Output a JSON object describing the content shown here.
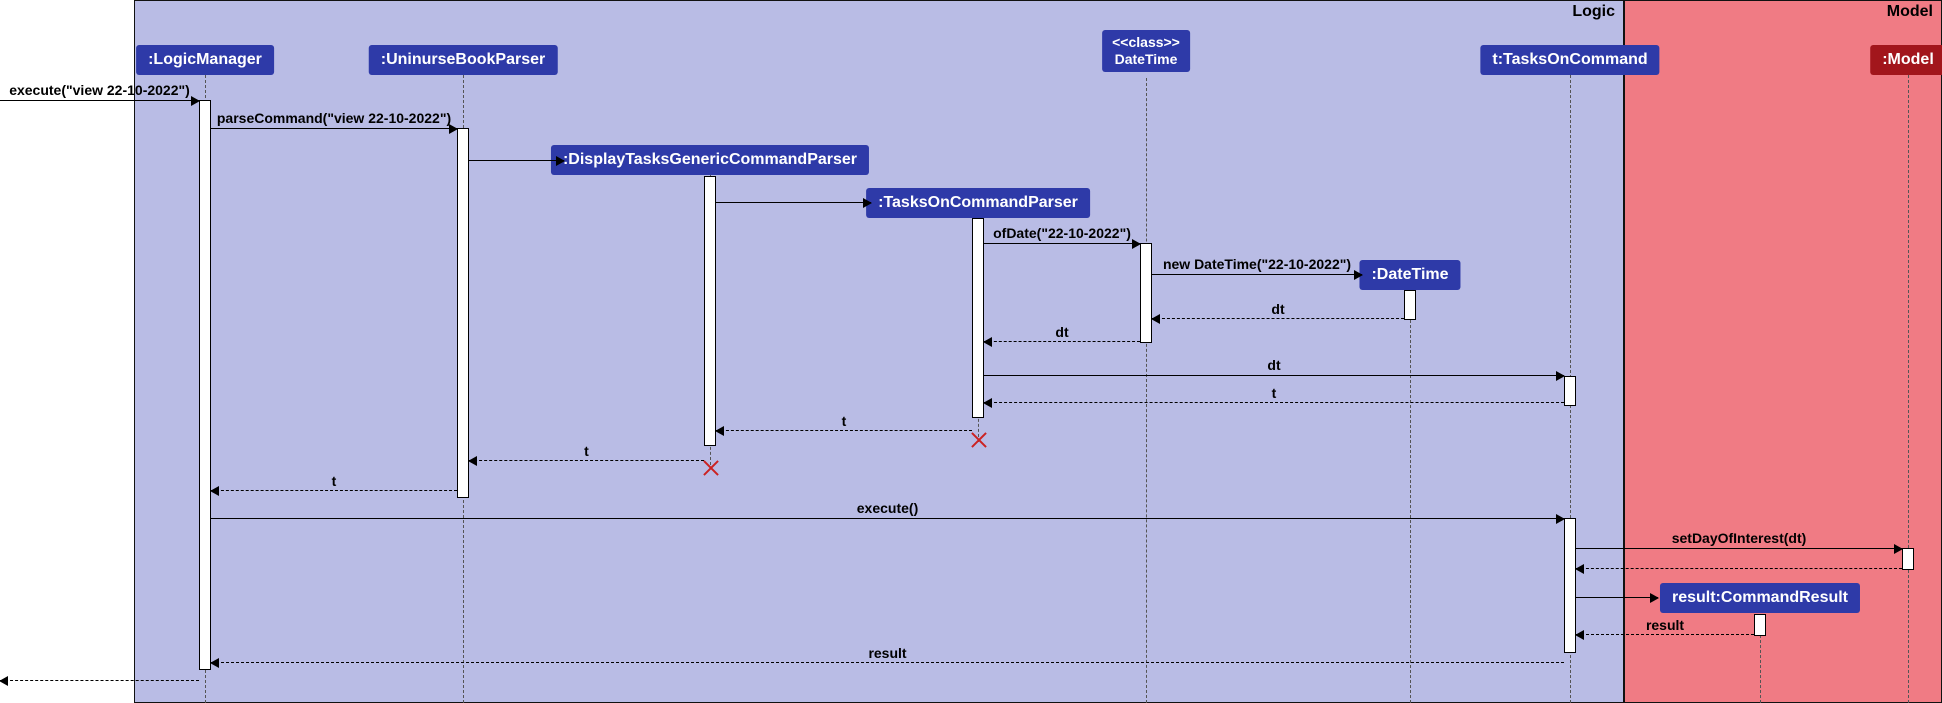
{
  "frames": {
    "logic": "Logic",
    "model": "Model"
  },
  "lifelines": {
    "logicManager": ":LogicManager",
    "uninurseBookParser": ":UninurseBookParser",
    "displayTasksGenericCommandParser": ":DisplayTasksGenericCommandParser",
    "tasksOnCommandParser": ":TasksOnCommandParser",
    "dateTimeClass_stereotype": "<<class>>",
    "dateTimeClass_name": "DateTime",
    "dateTimeInstance": ":DateTime",
    "tasksOnCommand": "t:TasksOnCommand",
    "commandResult": "result:CommandResult",
    "model": ":Model"
  },
  "messages": {
    "execute_view": "execute(\"view 22-10-2022\")",
    "parseCommand": "parseCommand(\"view 22-10-2022\")",
    "ofDate": "ofDate(\"22-10-2022\")",
    "newDateTime": "new DateTime(\"22-10-2022\")",
    "dt": "dt",
    "t": "t",
    "execute": "execute()",
    "setDayOfInterest": "setDayOfInterest(dt)",
    "result": "result"
  }
}
